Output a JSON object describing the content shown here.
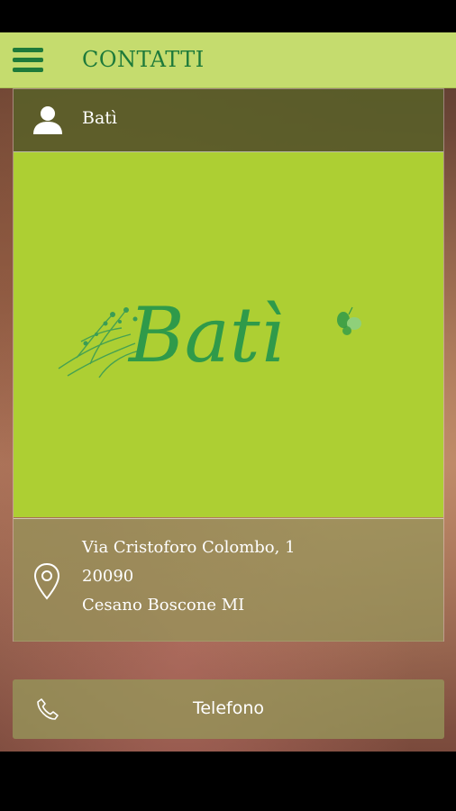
{
  "header": {
    "title": "CONTATTI",
    "menu_icon": "hamburger-menu-icon"
  },
  "contact": {
    "name": "Batì",
    "person_icon": "person-icon",
    "logo_text": "Batì",
    "address": {
      "icon": "map-pin-icon",
      "line1": "Via Cristoforo Colombo, 1",
      "line2": "20090",
      "line3": "Cesano Boscone MI"
    }
  },
  "phone": {
    "label": "Telefono",
    "icon": "phone-icon"
  },
  "colors": {
    "header_bg": "#c5dc6e",
    "header_text": "#1e7a3a",
    "logo_bg": "#adcf33",
    "logo_green": "#2f9a4a"
  }
}
